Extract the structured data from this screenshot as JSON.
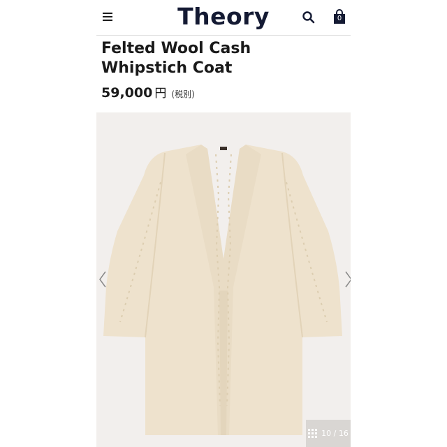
{
  "header": {
    "brand": "Theory",
    "bag_count": "0",
    "icons": [
      "hamburger-menu-icon",
      "search-icon",
      "shopping-bag-icon"
    ]
  },
  "product": {
    "title_line1": "Felted Wool Cash",
    "title_line2": "Whipstich Coat",
    "price": "59,000",
    "currency": "円",
    "tax_note": "(税別)"
  },
  "gallery": {
    "counter": "10 / 16",
    "icons": [
      "chevron-left-icon",
      "chevron-right-icon",
      "grid-icon"
    ]
  },
  "colors": {
    "brand": "#141a33",
    "coat": "#eee2cd",
    "gallery_bg": "#f2efed"
  }
}
